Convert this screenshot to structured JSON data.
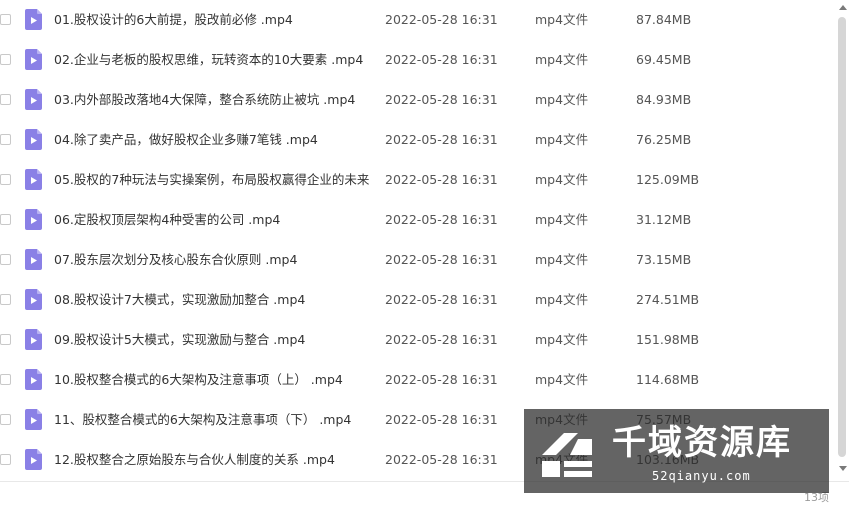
{
  "files": [
    {
      "name": "01.股权设计的6大前提，股改前必修 .mp4",
      "date": "2022-05-28 16:31",
      "type": "mp4文件",
      "size": "87.84MB"
    },
    {
      "name": "02.企业与老板的股权思维，玩转资本的10大要素 .mp4",
      "date": "2022-05-28 16:31",
      "type": "mp4文件",
      "size": "69.45MB"
    },
    {
      "name": "03.内外部股改落地4大保障，整合系统防止被坑 .mp4",
      "date": "2022-05-28 16:31",
      "type": "mp4文件",
      "size": "84.93MB"
    },
    {
      "name": "04.除了卖产品，做好股权企业多赚7笔钱 .mp4",
      "date": "2022-05-28 16:31",
      "type": "mp4文件",
      "size": "76.25MB"
    },
    {
      "name": "05.股权的7种玩法与实操案例，布局股权赢得企业的未来 ...",
      "date": "2022-05-28 16:31",
      "type": "mp4文件",
      "size": "125.09MB"
    },
    {
      "name": "06.定股权顶层架构4种受害的公司 .mp4",
      "date": "2022-05-28 16:31",
      "type": "mp4文件",
      "size": "31.12MB"
    },
    {
      "name": "07.股东层次划分及核心股东合伙原则 .mp4",
      "date": "2022-05-28 16:31",
      "type": "mp4文件",
      "size": "73.15MB"
    },
    {
      "name": "08.股权设计7大模式，实现激励加整合 .mp4",
      "date": "2022-05-28 16:31",
      "type": "mp4文件",
      "size": "274.51MB"
    },
    {
      "name": "09.股权设计5大模式，实现激励与整合 .mp4",
      "date": "2022-05-28 16:31",
      "type": "mp4文件",
      "size": "151.98MB"
    },
    {
      "name": "10.股权整合模式的6大架构及注意事项（上）   .mp4",
      "date": "2022-05-28 16:31",
      "type": "mp4文件",
      "size": "114.68MB"
    },
    {
      "name": "11、股权整合模式的6大架构及注意事项（下）  .mp4",
      "date": "2022-05-28 16:31",
      "type": "mp4文件",
      "size": "75.57MB"
    },
    {
      "name": "12.股权整合之原始股东与合伙人制度的关系 .mp4",
      "date": "2022-05-28 16:31",
      "type": "mp4文件",
      "size": "103.16MB"
    }
  ],
  "footer": {
    "item_count": "13项"
  },
  "watermark": {
    "text": "千域资源库",
    "url": "52qianyu.com"
  },
  "colors": {
    "file_icon": "#8a80e6",
    "file_icon_fold": "#b9b2f2",
    "watermark_bg": "#282828"
  },
  "icons": {
    "file": "video-file-icon",
    "logo": "watermark-logo-icon"
  }
}
